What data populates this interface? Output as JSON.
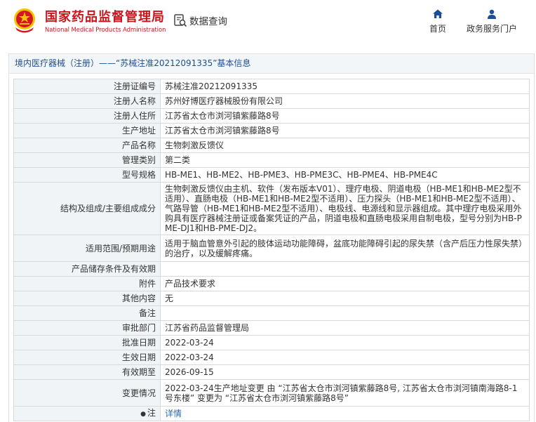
{
  "header": {
    "brand_cn": "国家药品监督管理局",
    "brand_en": "National Medical Products Administration",
    "query_label": "数据查询",
    "nav": [
      {
        "label": "首页",
        "icon": "home-icon"
      },
      {
        "label": "政务服务门户",
        "icon": "user-icon"
      }
    ],
    "brand_color": "#c8161d"
  },
  "panel": {
    "title": "境内医疗器械（注册）——“苏械注准20212091335”基本信息",
    "rows": [
      {
        "label": "注册证编号",
        "value": "苏械注准20212091335"
      },
      {
        "label": "注册人名称",
        "value": "苏州好博医疗器械股份有限公司"
      },
      {
        "label": "注册人住所",
        "value": "江苏省太仓市浏河镇紫藤路8号"
      },
      {
        "label": "生产地址",
        "value": "江苏省太仓市浏河镇紫藤路8号"
      },
      {
        "label": "产品名称",
        "value": "生物刺激反馈仪"
      },
      {
        "label": "管理类别",
        "value": "第二类"
      },
      {
        "label": "型号规格",
        "value": "HB-ME1、HB-ME2、HB-PME3、HB-PME3C、HB-PME4、HB-PME4C"
      },
      {
        "label": "结构及组成/主要组成成分",
        "value": "生物刺激反馈仪由主机、软件（发布版本V01）、理疗电极、阴道电极（HB-ME1和HB-ME2型不适用）、直肠电极（HB-ME1和HB-ME2型不适用）、压力探头（HB-ME1和HB-ME2型不适用）、气路导管（HB-ME1和HB-ME2型不适用）、电极线、电源线和显示器组成。其中理疗电极采用外购具有医疗器械注册证或备案凭证的产品，阴道电极和直肠电极采用自制电极，型号分别为HB-PME-DJ1和HB-PME-DJ2。"
      },
      {
        "label": "适用范围/预期用途",
        "value": "适用于脑血管意外引起的肢体运动功能障碍，盆底功能障碍引起的尿失禁（含产后压力性尿失禁）的治疗，以及缓解疼痛。"
      },
      {
        "label": "产品储存条件及有效期",
        "value": ""
      },
      {
        "label": "附件",
        "value": "产品技术要求"
      },
      {
        "label": "其他内容",
        "value": "无"
      },
      {
        "label": "备注",
        "value": ""
      },
      {
        "label": "审批部门",
        "value": "江苏省药品监督管理局"
      },
      {
        "label": "批准日期",
        "value": "2022-03-24"
      },
      {
        "label": "生效日期",
        "value": "2022-03-24"
      },
      {
        "label": "有效期至",
        "value": "2026-09-15"
      },
      {
        "label": "变更情况",
        "value": "2022-03-24生产地址变更 由 “江苏省太仓市浏河镇紫藤路8号, 江苏省太仓市浏河镇南海路8-1号东楼” 变更为 “江苏省太仓市浏河镇紫藤路8号”"
      },
      {
        "label": "注",
        "value": "详情"
      }
    ]
  }
}
